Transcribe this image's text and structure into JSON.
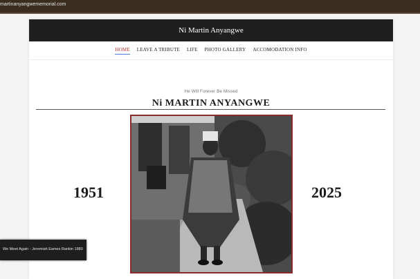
{
  "browser": {
    "url": "martinanyangwememorial.com"
  },
  "site": {
    "title": "Ni Martin Anyangwe"
  },
  "nav": [
    {
      "label": "HOME",
      "active": true
    },
    {
      "label": "LEAVE A TRIBUTE",
      "active": false
    },
    {
      "label": "LIFE",
      "active": false
    },
    {
      "label": "PHOTO GALLERY",
      "active": false
    },
    {
      "label": "ACCOMODATION INFO",
      "active": false
    }
  ],
  "hero": {
    "tagline": "He Will Forever Be Missed",
    "name": "Ni MARTIN ANYANGWE",
    "birth_year": "1951",
    "death_year": "2025"
  },
  "audio_player": {
    "track": "We Meet Again - Jeremiah Eames Rankin 1880"
  },
  "colors": {
    "header_bg": "#1f1f1f",
    "active_nav": "#b52a2a",
    "photo_border": "#8b2a2a"
  }
}
